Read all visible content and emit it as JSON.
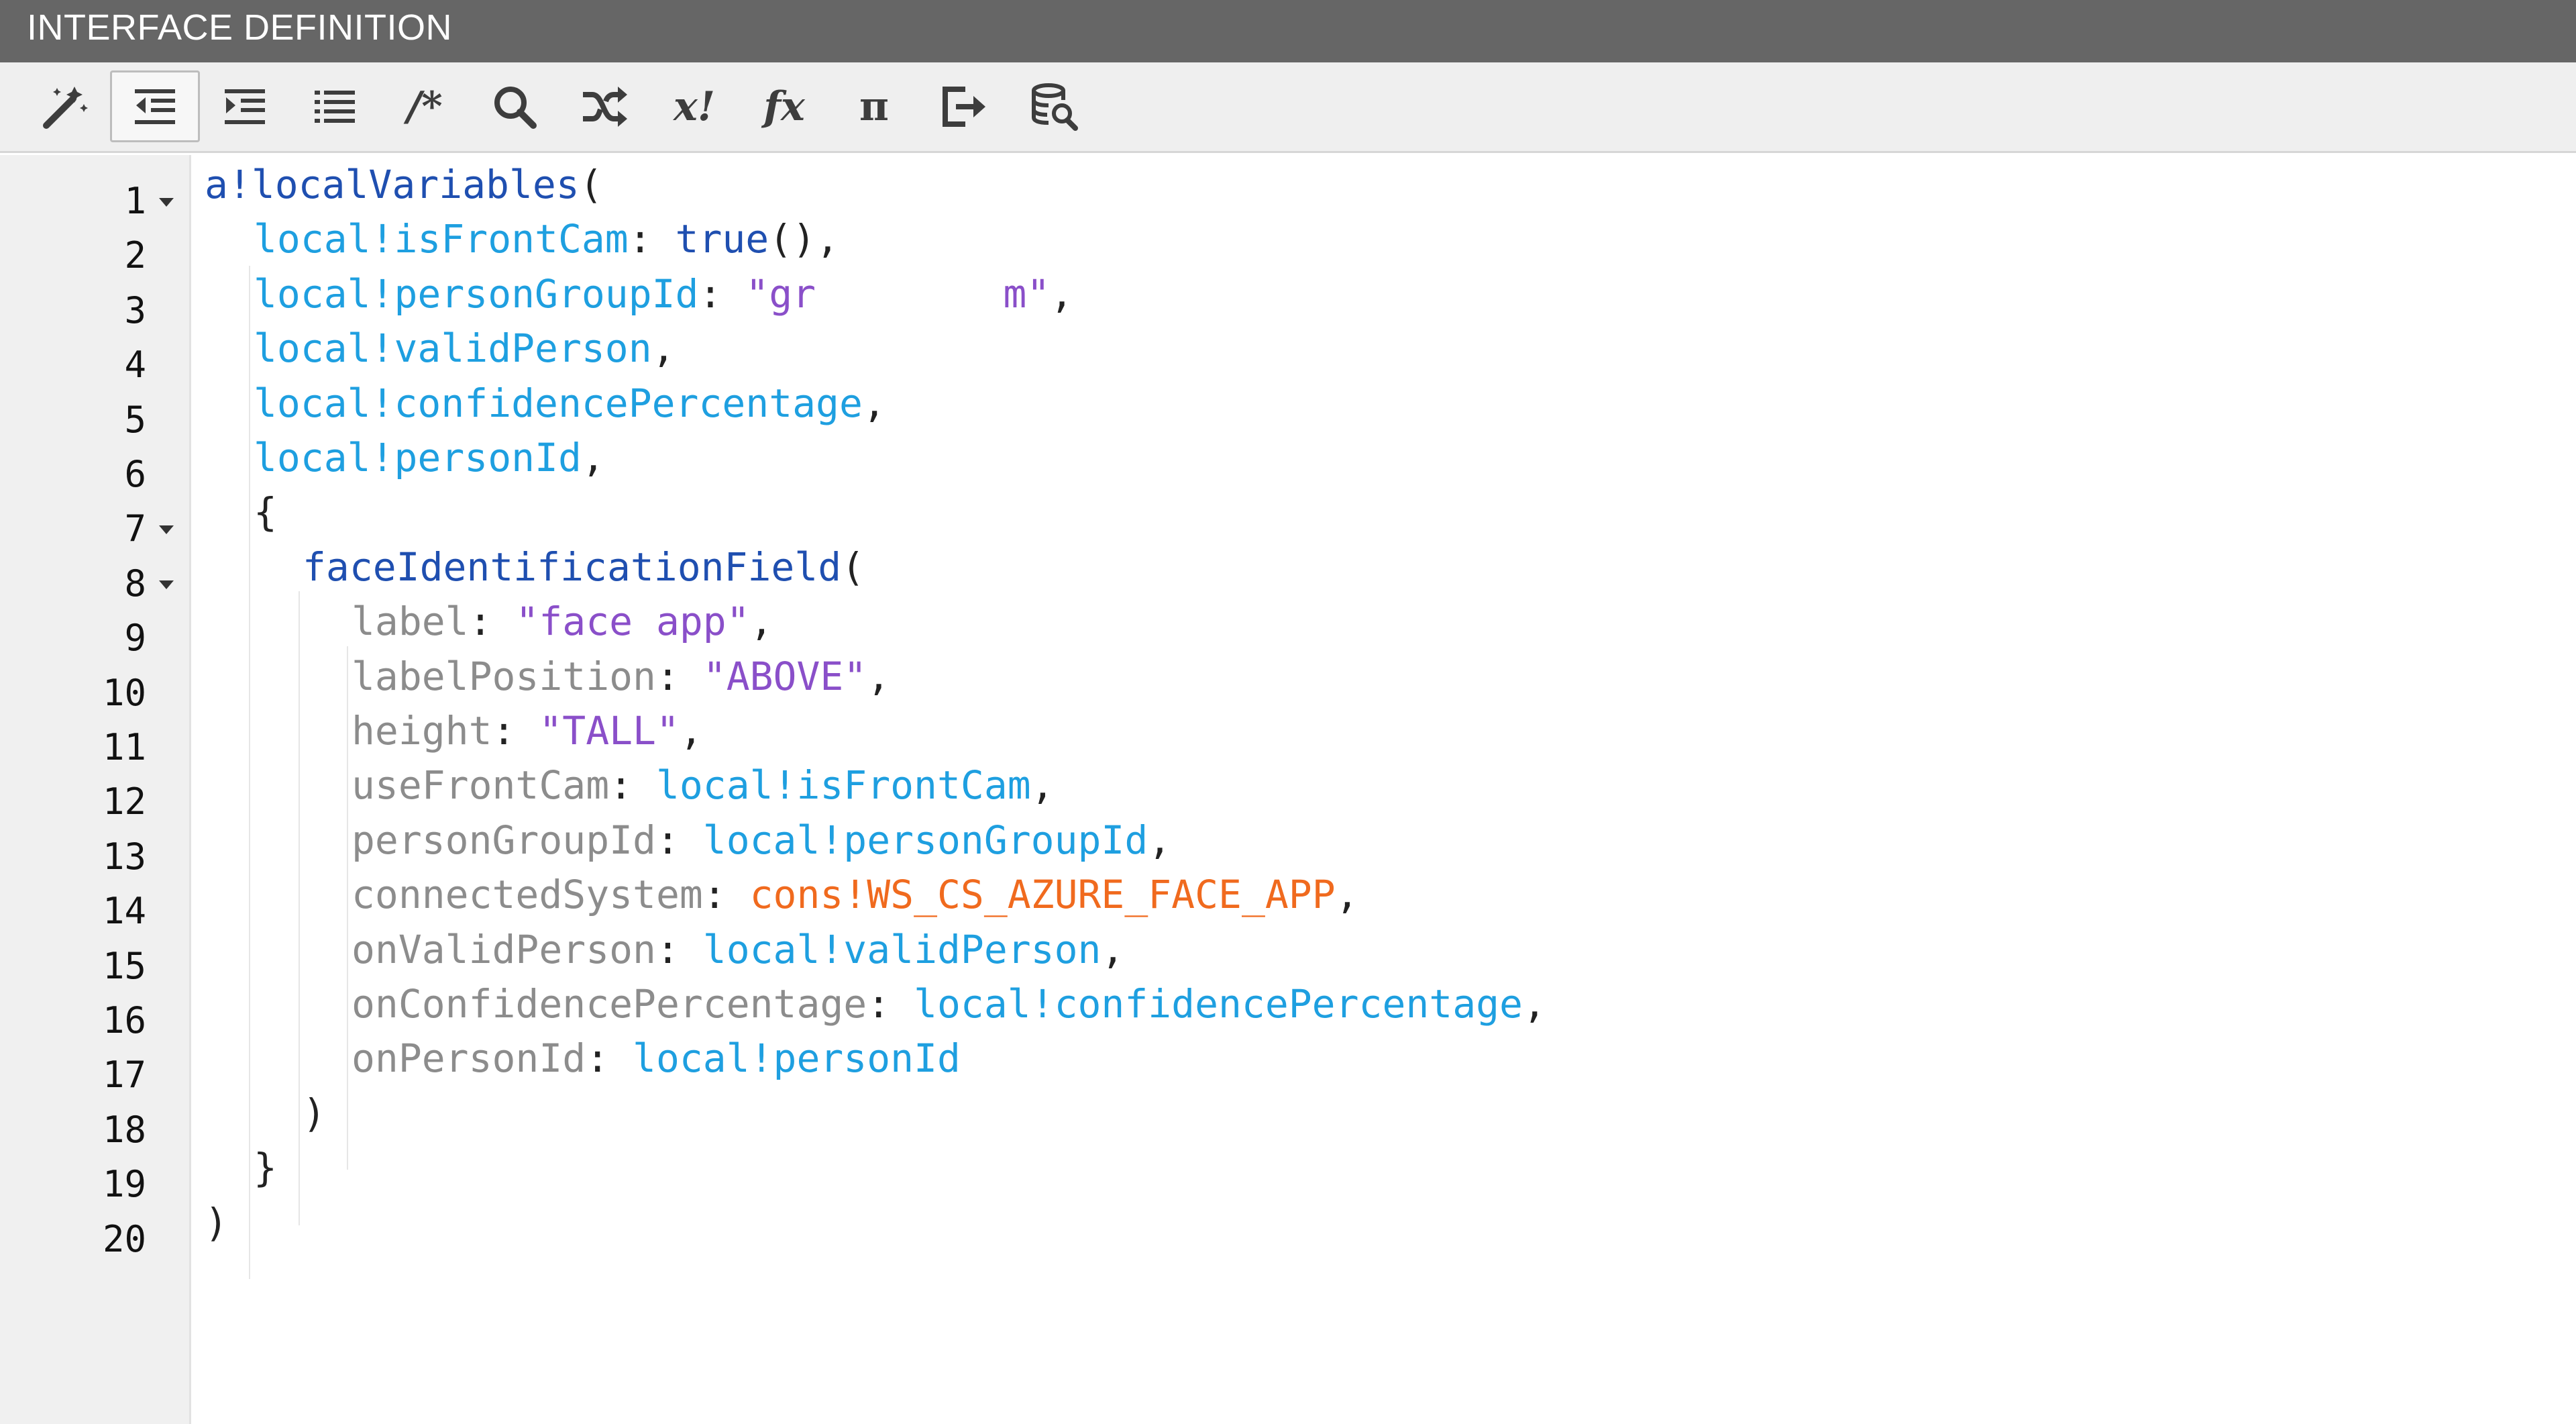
{
  "window": {
    "title": "INTERFACE DEFINITION"
  },
  "toolbar": {
    "buttons": [
      {
        "icon": "magic-wand-icon",
        "label": "Format"
      },
      {
        "icon": "outdent-icon",
        "label": "Outdent",
        "active": true
      },
      {
        "icon": "indent-icon",
        "label": "Indent"
      },
      {
        "icon": "list-icon",
        "label": "Lines"
      },
      {
        "icon": "comment-icon",
        "glyph": "/*"
      },
      {
        "icon": "search-icon"
      },
      {
        "icon": "shuffle-icon"
      },
      {
        "icon": "variable-icon",
        "glyph": "x!"
      },
      {
        "icon": "function-icon",
        "glyph": "fx"
      },
      {
        "icon": "pi-icon",
        "glyph": "π"
      },
      {
        "icon": "export-icon"
      },
      {
        "icon": "database-search-icon"
      }
    ]
  },
  "editor": {
    "colors": {
      "function": "#1f4fb0",
      "variable": "#1e9fe0",
      "string": "#8a4fc9",
      "keyword": "#8c8c8c",
      "constant": "#f06a1e",
      "punctuation": "#222222"
    },
    "lines": [
      {
        "n": "1",
        "fold": true,
        "indent": 0,
        "tokens": [
          [
            "fn",
            "a!localVariables"
          ],
          [
            "punc",
            "("
          ]
        ]
      },
      {
        "n": "2",
        "fold": false,
        "indent": 1,
        "tokens": [
          [
            "var",
            "local!isFrontCam"
          ],
          [
            "punc",
            ": "
          ],
          [
            "fn",
            "true"
          ],
          [
            "punc",
            "(),"
          ]
        ]
      },
      {
        "n": "3",
        "fold": false,
        "indent": 1,
        "tokens": [
          [
            "var",
            "local!personGroupId"
          ],
          [
            "punc",
            ": "
          ],
          [
            "str",
            "\"gr        m\""
          ],
          [
            "punc",
            ","
          ]
        ]
      },
      {
        "n": "4",
        "fold": false,
        "indent": 1,
        "tokens": [
          [
            "var",
            "local!validPerson"
          ],
          [
            "punc",
            ","
          ]
        ]
      },
      {
        "n": "5",
        "fold": false,
        "indent": 1,
        "tokens": [
          [
            "var",
            "local!confidencePercentage"
          ],
          [
            "punc",
            ","
          ]
        ]
      },
      {
        "n": "6",
        "fold": false,
        "indent": 1,
        "tokens": [
          [
            "var",
            "local!personId"
          ],
          [
            "punc",
            ","
          ]
        ]
      },
      {
        "n": "7",
        "fold": true,
        "indent": 1,
        "tokens": [
          [
            "punc",
            "{"
          ]
        ]
      },
      {
        "n": "8",
        "fold": true,
        "indent": 2,
        "tokens": [
          [
            "fn",
            "faceIdentificationField"
          ],
          [
            "punc",
            "("
          ]
        ]
      },
      {
        "n": "9",
        "fold": false,
        "indent": 3,
        "tokens": [
          [
            "key",
            "label"
          ],
          [
            "punc",
            ": "
          ],
          [
            "str",
            "\"face app\""
          ],
          [
            "punc",
            ","
          ]
        ]
      },
      {
        "n": "10",
        "fold": false,
        "indent": 3,
        "tokens": [
          [
            "key",
            "labelPosition"
          ],
          [
            "punc",
            ": "
          ],
          [
            "str",
            "\"ABOVE\""
          ],
          [
            "punc",
            ","
          ]
        ]
      },
      {
        "n": "11",
        "fold": false,
        "indent": 3,
        "tokens": [
          [
            "key",
            "height"
          ],
          [
            "punc",
            ": "
          ],
          [
            "str",
            "\"TALL\""
          ],
          [
            "punc",
            ","
          ]
        ]
      },
      {
        "n": "12",
        "fold": false,
        "indent": 3,
        "tokens": [
          [
            "key",
            "useFrontCam"
          ],
          [
            "punc",
            ": "
          ],
          [
            "var",
            "local!isFrontCam"
          ],
          [
            "punc",
            ","
          ]
        ]
      },
      {
        "n": "13",
        "fold": false,
        "indent": 3,
        "tokens": [
          [
            "key",
            "personGroupId"
          ],
          [
            "punc",
            ": "
          ],
          [
            "var",
            "local!personGroupId"
          ],
          [
            "punc",
            ","
          ]
        ]
      },
      {
        "n": "14",
        "fold": false,
        "indent": 3,
        "tokens": [
          [
            "key",
            "connectedSystem"
          ],
          [
            "punc",
            ": "
          ],
          [
            "cons",
            "cons!WS_CS_AZURE_FACE_APP"
          ],
          [
            "punc",
            ","
          ]
        ]
      },
      {
        "n": "15",
        "fold": false,
        "indent": 3,
        "tokens": [
          [
            "key",
            "onValidPerson"
          ],
          [
            "punc",
            ": "
          ],
          [
            "var",
            "local!validPerson"
          ],
          [
            "punc",
            ","
          ]
        ]
      },
      {
        "n": "16",
        "fold": false,
        "indent": 3,
        "tokens": [
          [
            "key",
            "onConfidencePercentage"
          ],
          [
            "punc",
            ": "
          ],
          [
            "var",
            "local!confidencePercentage"
          ],
          [
            "punc",
            ","
          ]
        ]
      },
      {
        "n": "17",
        "fold": false,
        "indent": 3,
        "tokens": [
          [
            "key",
            "onPersonId"
          ],
          [
            "punc",
            ": "
          ],
          [
            "var",
            "local!personId"
          ]
        ]
      },
      {
        "n": "18",
        "fold": false,
        "indent": 2,
        "tokens": [
          [
            "punc",
            ")"
          ]
        ]
      },
      {
        "n": "19",
        "fold": false,
        "indent": 1,
        "tokens": [
          [
            "punc",
            "}"
          ]
        ]
      },
      {
        "n": "20",
        "fold": false,
        "indent": 0,
        "tokens": [
          [
            "punc",
            ")"
          ]
        ]
      }
    ]
  }
}
